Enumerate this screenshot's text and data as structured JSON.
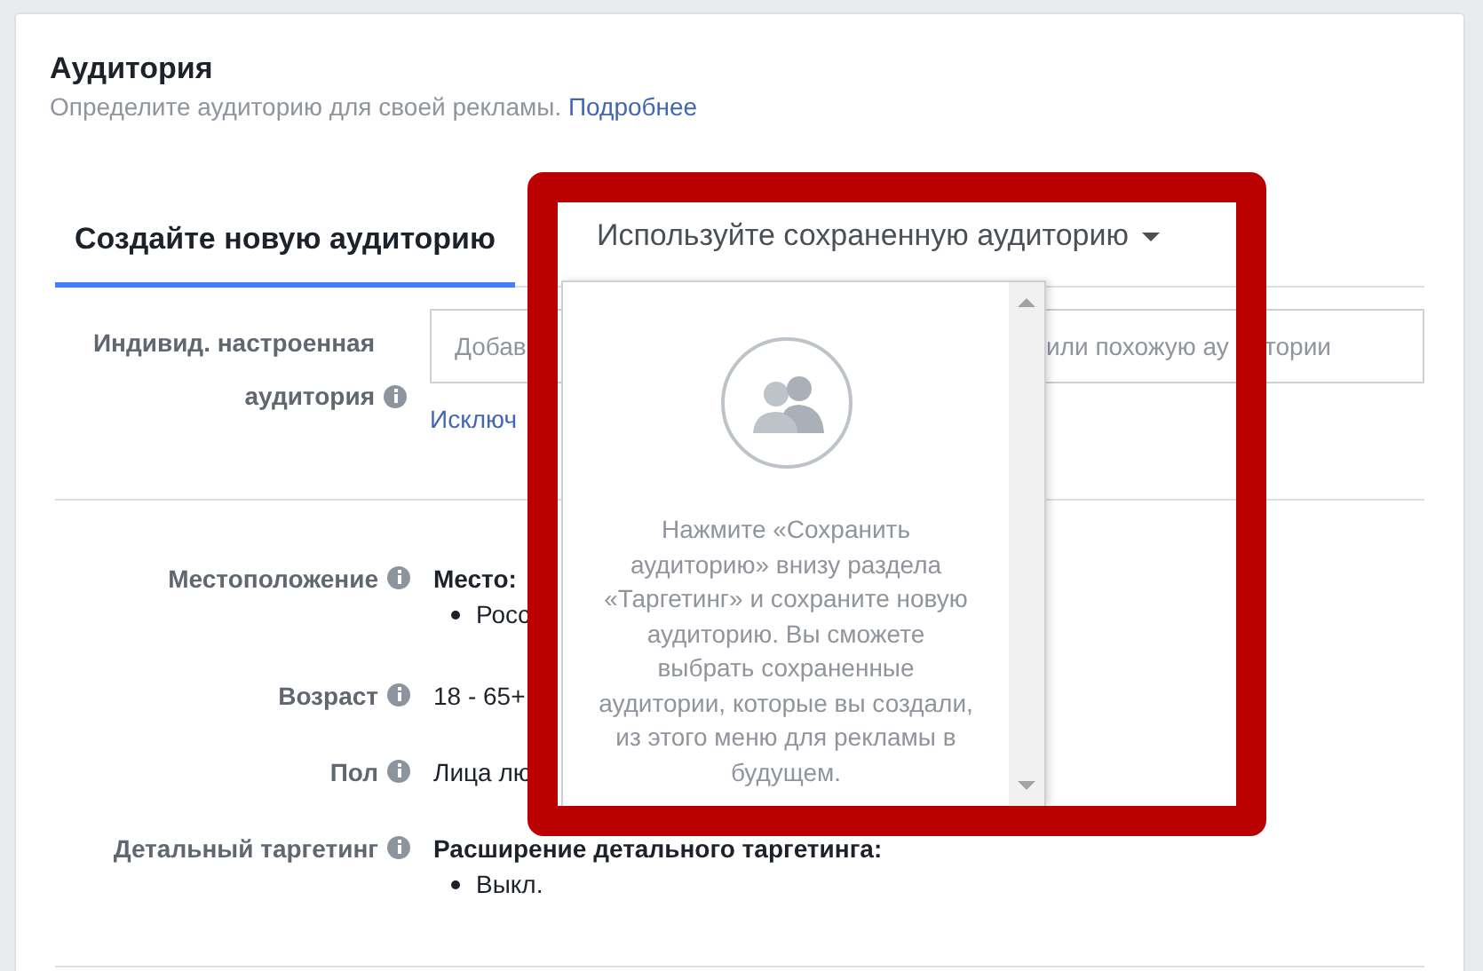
{
  "section": {
    "title": "Аудитория",
    "subtitle": "Определите аудиторию для своей рекламы.",
    "learn_more_link": "Подробнее"
  },
  "tabs": [
    {
      "label": "Создайте новую аудиторию",
      "selected": true
    },
    {
      "label": "Используйте сохраненную аудиторию",
      "selected": false
    }
  ],
  "custom_audience": {
    "label": "Индивид. настроенная аудитория",
    "placeholder_parts": [
      "Добав",
      "или похожую ау",
      "тории"
    ],
    "exclude_link": "Исключ"
  },
  "summary": [
    {
      "label": "Местоположение",
      "heading": "Место:",
      "bullets": [
        "Росс"
      ]
    },
    {
      "label": "Возраст",
      "value": "18 - 65+"
    },
    {
      "label": "Пол",
      "value": "Лица лю"
    },
    {
      "label": "Детальный таргетинг",
      "heading": "Расширение детального таргетинга:",
      "bullets": [
        "Выкл."
      ]
    }
  ],
  "dropdown": {
    "message": "Нажмите «Сохранить аудиторию» внизу раздела «Таргетинг» и сохраните новую аудиторию. Вы сможете выбрать сохраненные аудитории, которые вы создали, из этого меню для рекламы в будущем."
  }
}
